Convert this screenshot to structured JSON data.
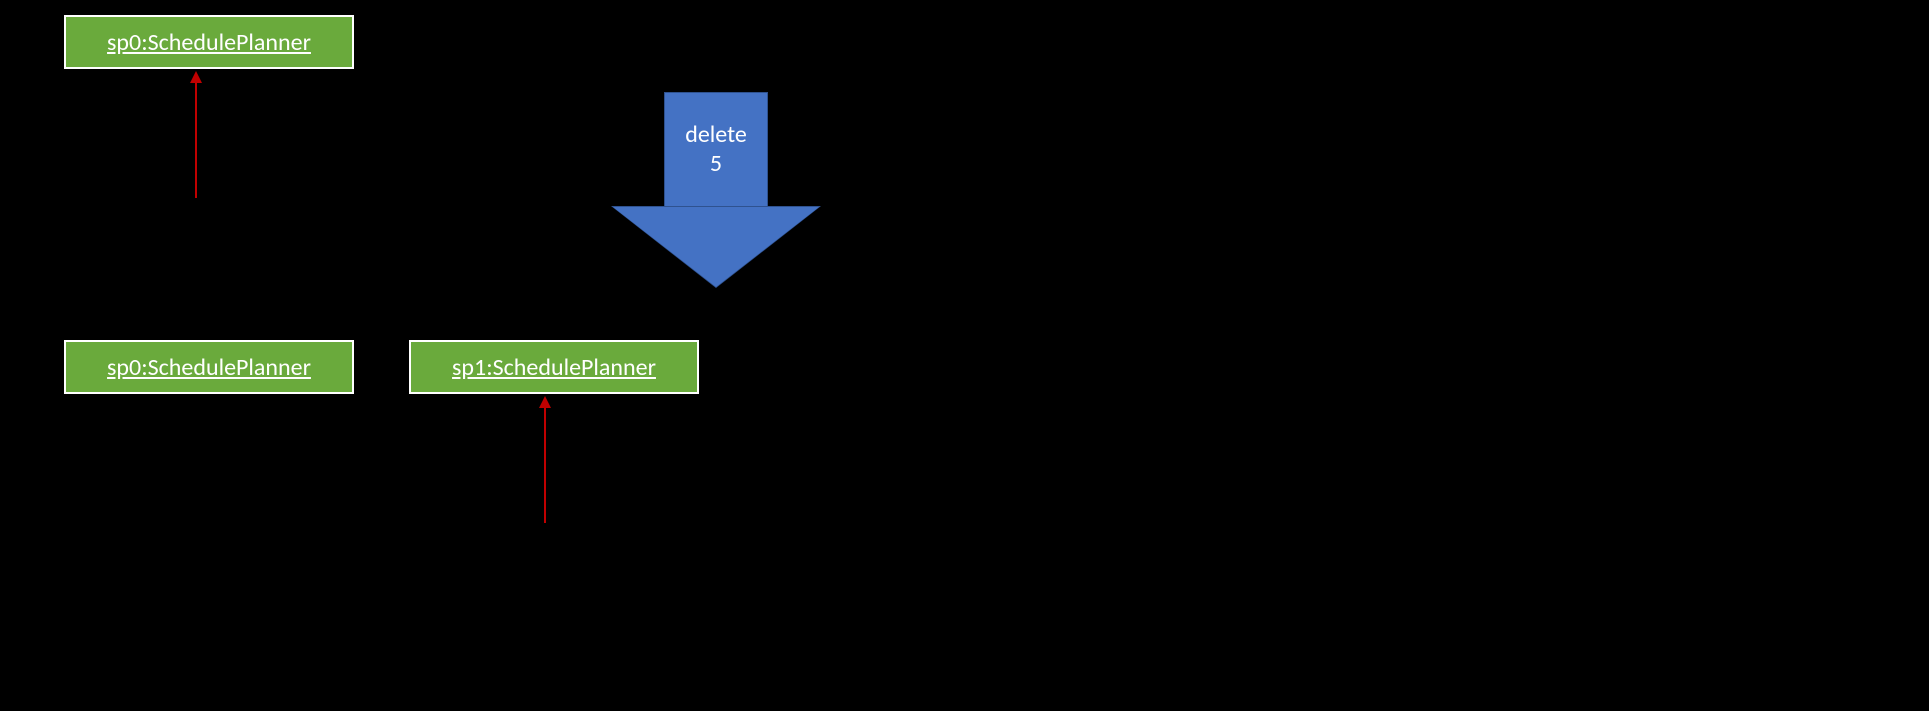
{
  "objects": {
    "sp0_top": "sp0:SchedulePlanner",
    "sp0_bottom": "sp0:SchedulePlanner",
    "sp1_bottom": "sp1:SchedulePlanner"
  },
  "arrow": {
    "label_line1": "delete",
    "label_line2": "5"
  }
}
